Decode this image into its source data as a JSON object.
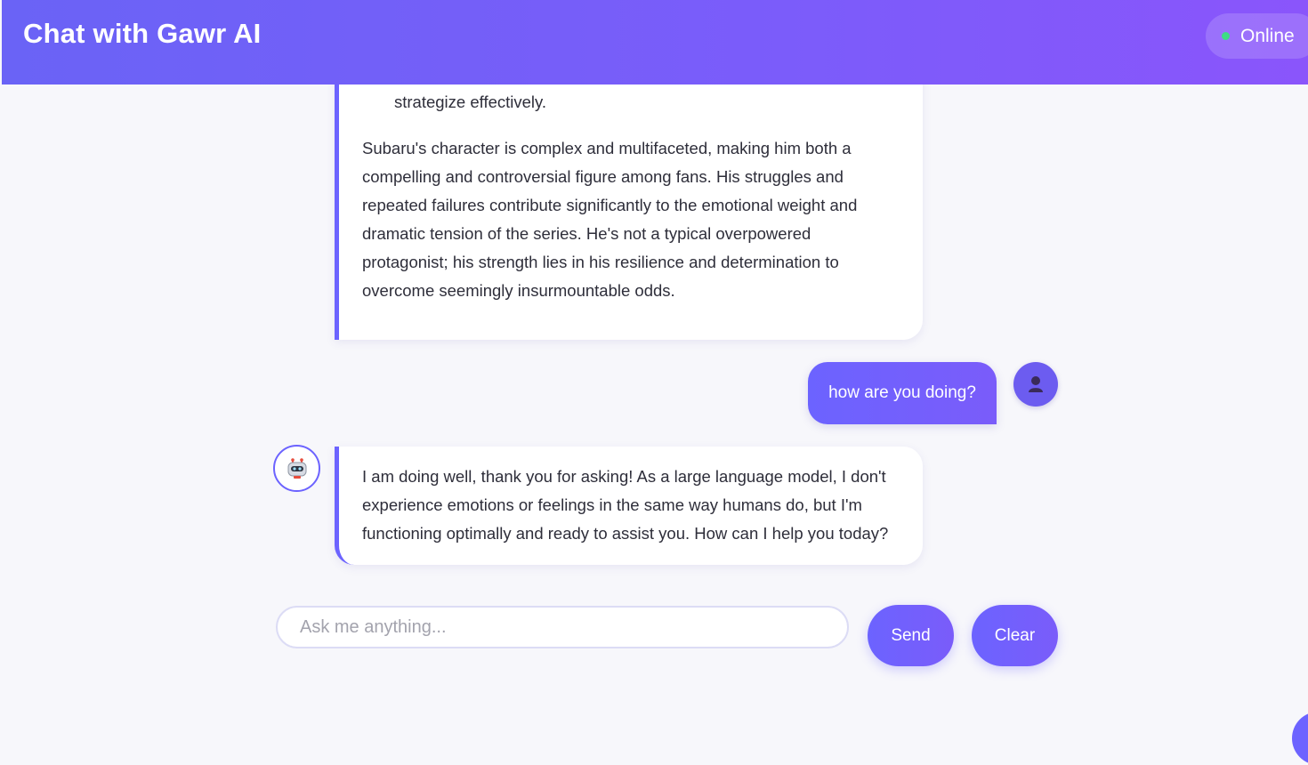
{
  "header": {
    "title": "Chat with Gawr AI",
    "status": "Online",
    "status_color": "#3ddc84",
    "gradient_start": "#6a63f6",
    "gradient_end": "#8a55fb"
  },
  "messages": {
    "previous_bot": {
      "list_item_tail": "strategize effectively.",
      "paragraph": "Subaru's character is complex and multifaceted, making him both a compelling and controversial figure among fans. His struggles and repeated failures contribute significantly to the emotional weight and dramatic tension of the series. He's not a typical overpowered protagonist; his strength lies in his resilience and determination to overcome seemingly insurmountable odds."
    },
    "user": {
      "text": "how are you doing?",
      "avatar_icon": "user-silhouette-icon"
    },
    "bot_reply": {
      "text": "I am doing well, thank you for asking! As a large language model, I don't experience emotions or feelings in the same way humans do, but I'm functioning optimally and ready to assist you. How can I help you today?",
      "avatar_icon": "robot-icon"
    }
  },
  "composer": {
    "placeholder": "Ask me anything...",
    "value": "",
    "send_label": "Send",
    "clear_label": "Clear"
  },
  "accent_color": "#6c63ff"
}
